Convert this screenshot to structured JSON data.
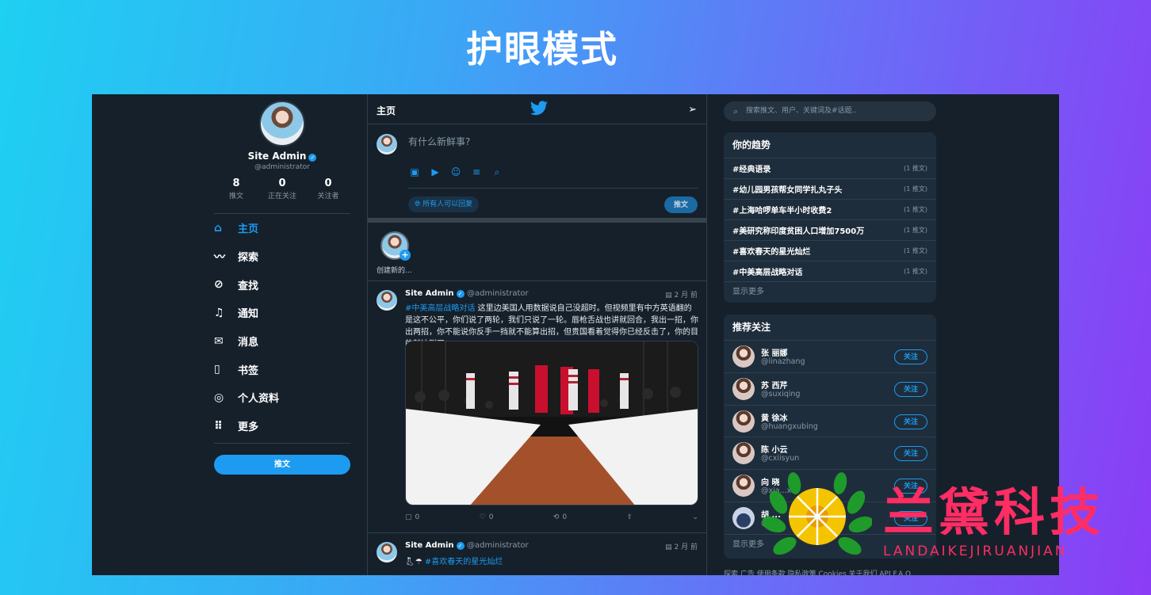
{
  "banner": {
    "title": "护眼模式"
  },
  "profile": {
    "name": "Site Admin",
    "handle": "@administrator",
    "stats": [
      {
        "num": "8",
        "label": "推文"
      },
      {
        "num": "0",
        "label": "正在关注"
      },
      {
        "num": "0",
        "label": "关注者"
      }
    ]
  },
  "nav": {
    "items": [
      {
        "label": "主页",
        "icon": "home-icon"
      },
      {
        "label": "探索",
        "icon": "activity-icon"
      },
      {
        "label": "查找",
        "icon": "compass-icon"
      },
      {
        "label": "通知",
        "icon": "bell-icon"
      },
      {
        "label": "消息",
        "icon": "mail-icon"
      },
      {
        "label": "书签",
        "icon": "book-icon"
      },
      {
        "label": "个人资料",
        "icon": "profile-icon"
      },
      {
        "label": "更多",
        "icon": "grid-icon"
      }
    ],
    "tweet_button": "推文"
  },
  "header": {
    "title": "主页"
  },
  "compose": {
    "placeholder": "有什么新鲜事?",
    "reply_setting": "所有人可以回复",
    "submit": "推文"
  },
  "stories": {
    "label": "创建新的..."
  },
  "tweets": [
    {
      "name": "Site Admin",
      "handle": "@administrator",
      "time": "2 月 前",
      "hashtag": "#中美高层战略对话",
      "text": " 这里边美国人用数据说自己没超时。但视频里有中方英语翻的是这不公平，你们说了两轮，我们只说了一轮。唇枪舌战也讲就回合，我出一招，你出两招，你不能说你反手一挡就不能算出招，但贵国看着觉得你已经反击了，你的目的就达到了。",
      "actions": {
        "reply": "0",
        "like": "0",
        "retweet": "0"
      }
    },
    {
      "name": "Site Admin",
      "handle": "@administrator",
      "time": "2 月 前",
      "hashtag": "#喜欢春天的星光灿烂"
    }
  ],
  "search": {
    "placeholder": "搜索推文、用户、关键词及#话题.."
  },
  "trends": {
    "title": "你的趋势",
    "items": [
      {
        "name": "#经典语录",
        "count": "(1 推文)"
      },
      {
        "name": "#幼儿园男孩帮女同学扎丸子头",
        "count": "(1 推文)"
      },
      {
        "name": "#上海哈啰单车半小时收费2",
        "count": "(1 推文)"
      },
      {
        "name": "#美研究称印度贫困人口增加7500万",
        "count": "(1 推文)"
      },
      {
        "name": "#喜欢春天的星光灿烂",
        "count": "(1 推文)"
      },
      {
        "name": "#中美高层战略对话",
        "count": "(1 推文)"
      }
    ],
    "show_more": "显示更多"
  },
  "follow": {
    "title": "推荐关注",
    "users": [
      {
        "name": "张 丽娜",
        "handle": "@linazhang"
      },
      {
        "name": "苏 西芹",
        "handle": "@suxiqing"
      },
      {
        "name": "黄 徐冰",
        "handle": "@huangxubing"
      },
      {
        "name": "陈 小云",
        "handle": "@cxiisyun"
      },
      {
        "name": "向 晓",
        "handle": "@xia...x"
      },
      {
        "name": "胡 ...",
        "handle": "@..."
      }
    ],
    "button": "关注",
    "show_more": "显示更多"
  },
  "footer": {
    "links": "探索   广告   使用条款   隐私政策   Cookies   关于我们   API   F.A.Q"
  },
  "watermark": {
    "title": "兰黛科技",
    "subtitle": "LANDAIKEJIRUANJIAN"
  }
}
